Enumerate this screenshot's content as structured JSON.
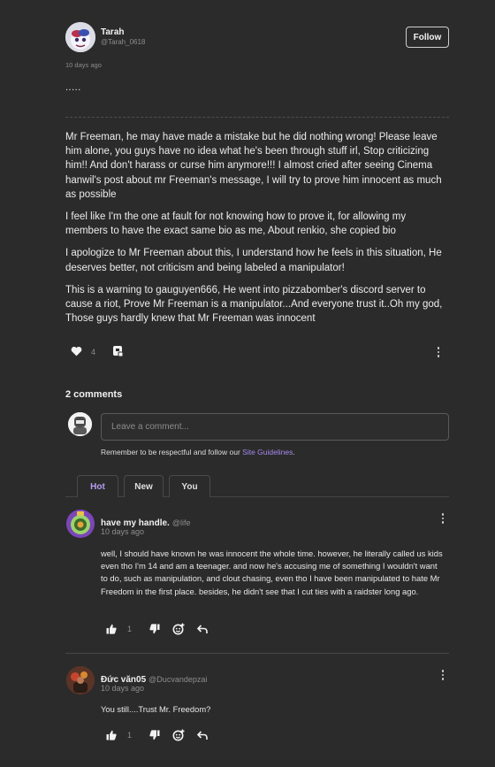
{
  "post": {
    "author": {
      "name": "Tarah",
      "handle": "@Tarah_0618"
    },
    "time": "10 days ago",
    "follow_label": "Follow",
    "intro": ".....",
    "paragraphs": [
      "Mr Freeman, he may have made a mistake but he did nothing wrong! Please leave him alone, you guys have no idea what he's been through stuff irl, Stop criticizing him!! And don't harass or curse him anymore!!! I almost cried after seeing Cinema hanwil's post about mr Freeman's message, I will try to prove him innocent as much as possible",
      "I feel like I'm the one at fault for not knowing how to prove it, for allowing my members to have the exact same bio as me, About renkio, she copied bio",
      "I apologize to Mr Freeman about this, I understand how he feels in this situation, He deserves better, not criticism and being labeled a manipulator!",
      "This is a warning to gauguyen666, He went into pizzabomber's discord server to cause a riot, Prove Mr Freeman is a manipulator...And everyone trust it..Oh my god, Those guys hardly knew that Mr Freeman was innocent"
    ],
    "like_count": "4"
  },
  "comments_section": {
    "count_label": "2 comments",
    "input_placeholder": "Leave a comment...",
    "guidelines_prefix": "Remember to be respectful and follow our ",
    "guidelines_link": "Site Guidelines",
    "guidelines_suffix": ".",
    "tabs": [
      "Hot",
      "New",
      "You"
    ],
    "active_tab": "Hot"
  },
  "comments": [
    {
      "name": "have my handle.",
      "handle": "@life",
      "time": "10 days ago",
      "text": "well, I should have known he was innocent the whole time. however, he literally called us kids even tho I'm 14 and am a teenager. and now he's accusing me of something I wouldn't want to do, such as manipulation, and clout chasing, even tho I have been manipulated to hate Mr Freedom in the first place. besides, he didn't see that I cut ties with a raidster long ago.",
      "likes": "1"
    },
    {
      "name": "Đức văn05",
      "handle": "@Ducvandepzai",
      "time": "10 days ago",
      "text": "You still....Trust Mr. Freedom?",
      "likes": "1"
    }
  ],
  "colors": {
    "background": "#2b2b2b",
    "accent": "#b79cf5",
    "link": "#a68af0"
  }
}
